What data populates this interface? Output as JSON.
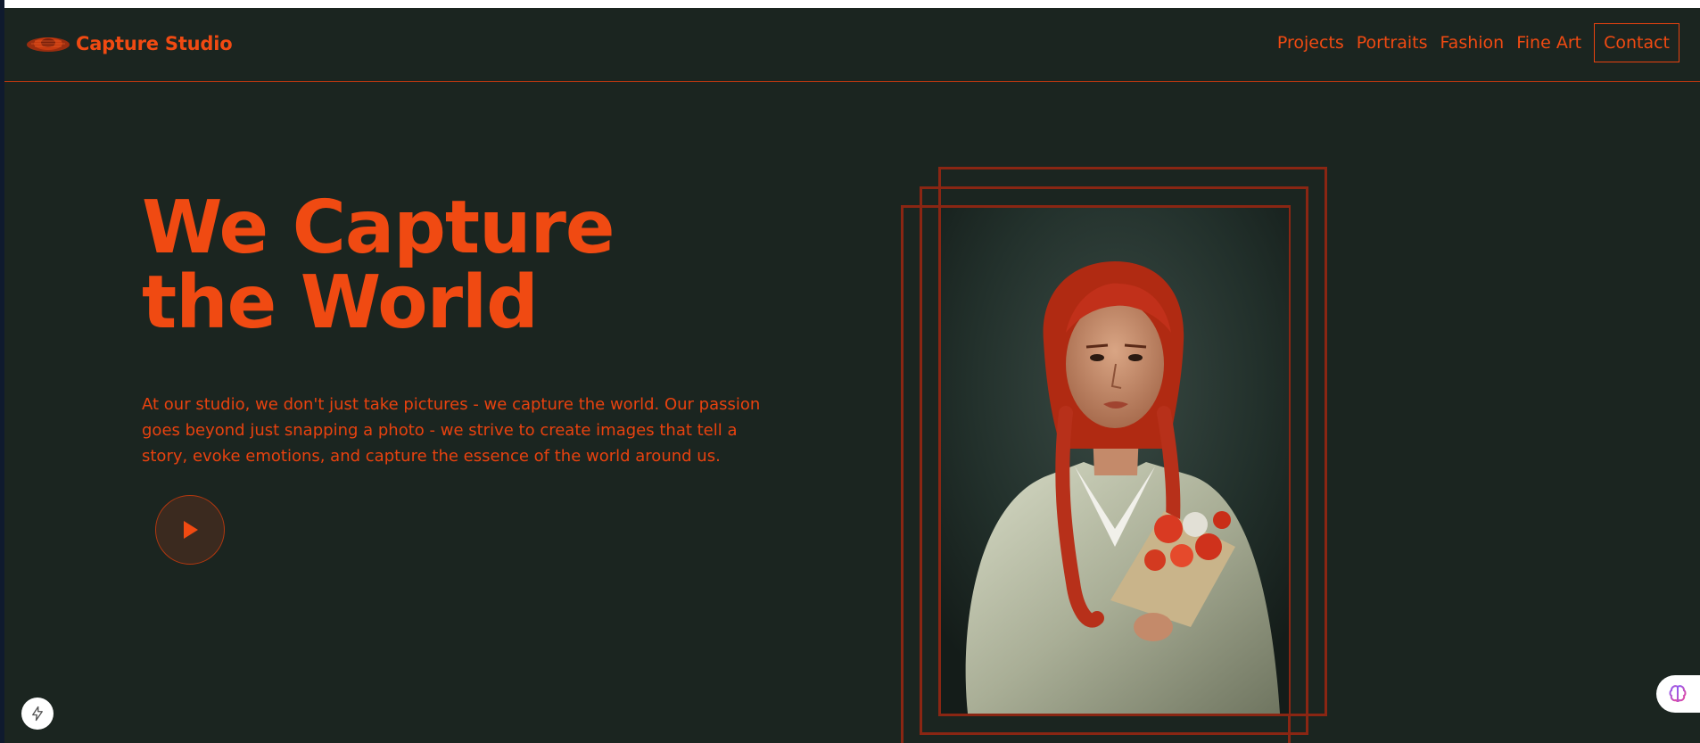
{
  "brand": {
    "name": "Capture Studio",
    "logo_icon": "photo-studio-logo-icon",
    "accent_color": "#f04a12",
    "background_color": "#1b2520"
  },
  "nav": {
    "items": [
      {
        "label": "Projects"
      },
      {
        "label": "Portraits"
      },
      {
        "label": "Fashion"
      },
      {
        "label": "Fine Art"
      }
    ],
    "contact_label": "Contact"
  },
  "hero": {
    "title_line1": "We Capture",
    "title_line2": "the World",
    "description": "At our studio, we don't just take pictures - we capture the world. Our passion goes beyond just snapping a photo - we strive to create images that tell a story, evoke emotions, and capture the essence of the world around us.",
    "play_icon": "play-icon"
  },
  "portrait": {
    "icon": "portrait-photo"
  },
  "widgets": {
    "bolt_icon": "lightning-bolt-icon",
    "brain_icon": "brain-icon"
  }
}
